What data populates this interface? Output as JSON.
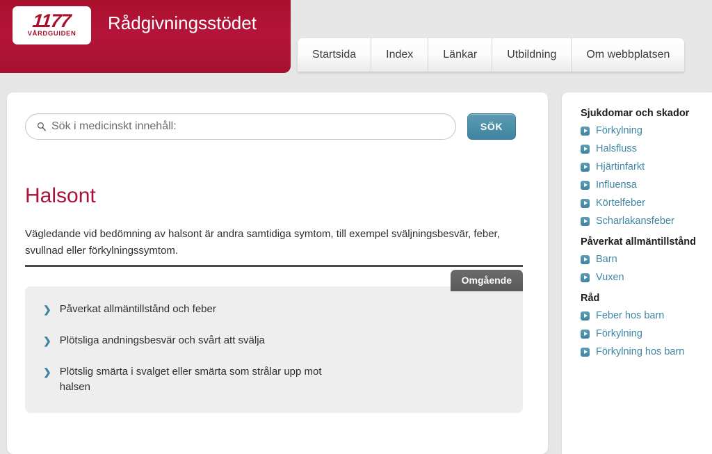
{
  "header": {
    "logo": {
      "number": "1177",
      "subtitle": "VÅRDGUIDEN",
      "name": "1177-vardguiden-logo"
    },
    "site_title": "Rådgivningsstödet",
    "background_color": "#b5143a"
  },
  "nav": {
    "items": [
      {
        "label": "Startsida"
      },
      {
        "label": "Index"
      },
      {
        "label": "Länkar"
      },
      {
        "label": "Utbildning"
      },
      {
        "label": "Om webbplatsen"
      }
    ]
  },
  "search": {
    "placeholder": "Sök i medicinskt innehåll:",
    "value": "",
    "button_label": "SÖK",
    "button_color": "#4d90a8",
    "icon": "search-icon"
  },
  "main": {
    "title": "Halsont",
    "title_color": "#a8123c",
    "intro": "Vägledande vid bedömning av halsont är andra samtidiga symtom, till exempel sväljningsbesvär, feber, svullnad eller förkylningssymtom.",
    "tab": {
      "label": "Omgående",
      "color": "#5a5a5a"
    },
    "bullets": [
      {
        "text": "Påverkat allmäntillstånd och feber"
      },
      {
        "text": "Plötsliga andningsbesvär och svårt att svälja"
      },
      {
        "text": "Plötslig smärta i svalget eller smärta som strålar upp mot halsen"
      }
    ],
    "bullet_marker": "❯",
    "bullet_marker_color": "#3f83a0"
  },
  "sidebar": {
    "groups": [
      {
        "heading": "Sjukdomar och skador",
        "links": [
          {
            "label": "Förkylning"
          },
          {
            "label": "Halsfluss"
          },
          {
            "label": "Hjärtinfarkt"
          },
          {
            "label": "Influensa"
          },
          {
            "label": "Körtelfeber"
          },
          {
            "label": "Scharlakansfeber"
          }
        ]
      },
      {
        "heading": "Påverkat allmäntillstånd",
        "links": [
          {
            "label": "Barn"
          },
          {
            "label": "Vuxen"
          }
        ]
      },
      {
        "heading": "Råd",
        "links": [
          {
            "label": "Feber hos barn"
          },
          {
            "label": "Förkylning"
          },
          {
            "label": "Förkylning hos barn"
          }
        ]
      }
    ],
    "link_color": "#3f86a4"
  }
}
